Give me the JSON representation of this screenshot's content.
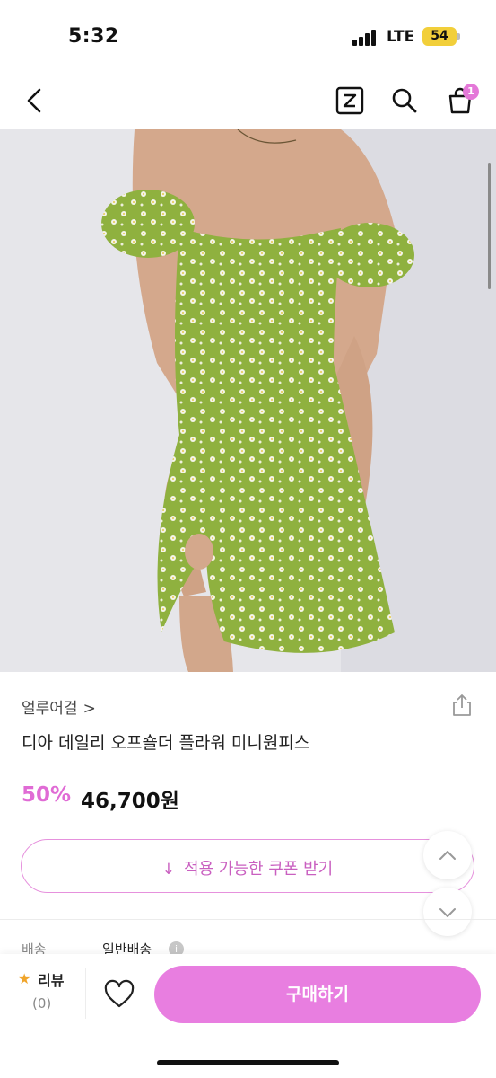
{
  "status_bar": {
    "time": "5:32",
    "network": "LTE",
    "battery": "54"
  },
  "nav": {
    "cart_badge": "1"
  },
  "product": {
    "brand": "얼루어걸",
    "brand_chevron": ">",
    "title": "디아 데일리 오프숄더 플라워 미니원피스",
    "discount": "50%",
    "price": "46,700원",
    "image_colors": {
      "dress": "#8fb13f",
      "background": "#e6e6ea",
      "skin": "#d4a88c"
    }
  },
  "coupon": {
    "arrow": "↓",
    "label": "적용 가능한 쿠폰 받기"
  },
  "shipping": {
    "key": "배송",
    "value": "일반배송",
    "info": "i"
  },
  "bottom_bar": {
    "review_star": "★",
    "review_label": "리뷰",
    "review_count": "(0)",
    "buy_label": "구매하기"
  },
  "colors": {
    "accent": "#e87ee0",
    "discount": "#e06bd5",
    "coupon_border": "#e691dd"
  }
}
